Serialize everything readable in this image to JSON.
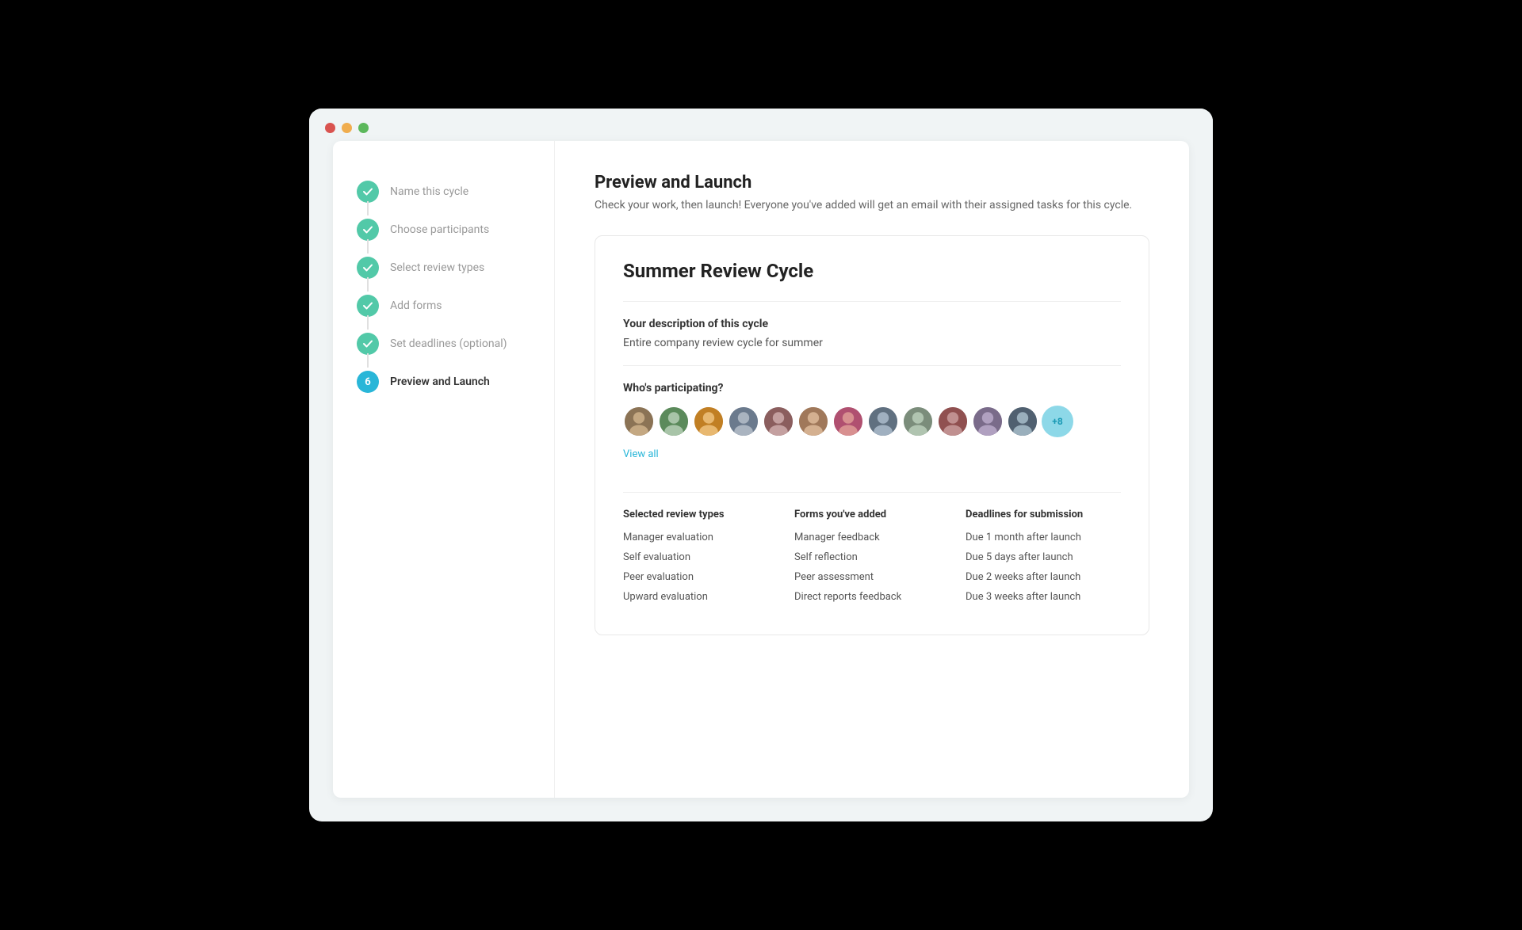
{
  "window": {
    "titlebar": {
      "dots": [
        "red",
        "yellow",
        "green"
      ]
    }
  },
  "sidebar": {
    "steps": [
      {
        "id": 1,
        "label": "Name this cycle",
        "state": "completed"
      },
      {
        "id": 2,
        "label": "Choose participants",
        "state": "completed"
      },
      {
        "id": 3,
        "label": "Select review types",
        "state": "completed"
      },
      {
        "id": 4,
        "label": "Add forms",
        "state": "completed"
      },
      {
        "id": 5,
        "label": "Set deadlines (optional)",
        "state": "completed"
      },
      {
        "id": 6,
        "label": "Preview and Launch",
        "state": "active"
      }
    ]
  },
  "content": {
    "page_title": "Preview and Launch",
    "page_subtitle": "Check your work, then launch! Everyone you've added will get an email with their assigned tasks for this cycle.",
    "cycle_name": "Summer Review Cycle",
    "description_label": "Your description of this cycle",
    "description_text": "Entire company review cycle for summer",
    "participating_label": "Who's participating?",
    "avatars_extra": "+8",
    "view_all": "View all",
    "review_section": {
      "col1_title": "Selected review types",
      "col1_items": [
        "Manager evaluation",
        "Self evaluation",
        "Peer evaluation",
        "Upward evaluation"
      ],
      "col2_title": "Forms you've added",
      "col2_items": [
        "Manager feedback",
        "Self reflection",
        "Peer assessment",
        "Direct reports feedback"
      ],
      "col3_title": "Deadlines for submission",
      "col3_items": [
        "Due 1 month after launch",
        "Due 5 days after launch",
        "Due 2 weeks after launch",
        "Due 3 weeks after launch"
      ]
    }
  },
  "colors": {
    "completed": "#52c9a8",
    "active": "#29b6d8",
    "link": "#29b6d8"
  }
}
